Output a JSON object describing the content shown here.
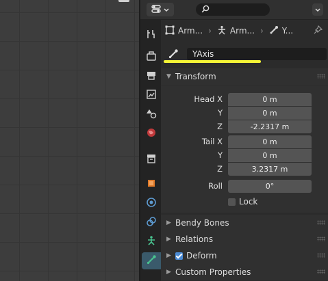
{
  "header": {
    "search_placeholder": ""
  },
  "breadcrumb": {
    "items": [
      {
        "label": "Arm..."
      },
      {
        "label": "Arm..."
      },
      {
        "label": "Y..."
      }
    ]
  },
  "bone": {
    "name": "YAxis"
  },
  "transform": {
    "title": "Transform",
    "head_x_label": "Head X",
    "head_y_label": "Y",
    "head_z_label": "Z",
    "head_x": "0 m",
    "head_y": "0 m",
    "head_z": "-2.2317 m",
    "tail_x_label": "Tail X",
    "tail_y_label": "Y",
    "tail_z_label": "Z",
    "tail_x": "0 m",
    "tail_y": "0 m",
    "tail_z": "3.2317 m",
    "roll_label": "Roll",
    "roll": "0°",
    "lock_label": "Lock",
    "lock_checked": false
  },
  "panels": {
    "bendy_bones": "Bendy Bones",
    "relations": "Relations",
    "deform": "Deform",
    "deform_checked": true,
    "custom_properties": "Custom Properties"
  },
  "colors": {
    "highlight": "#f4f436",
    "active_tab": "#3a5a6b",
    "checkbox_checked": "#4a8ad3"
  }
}
